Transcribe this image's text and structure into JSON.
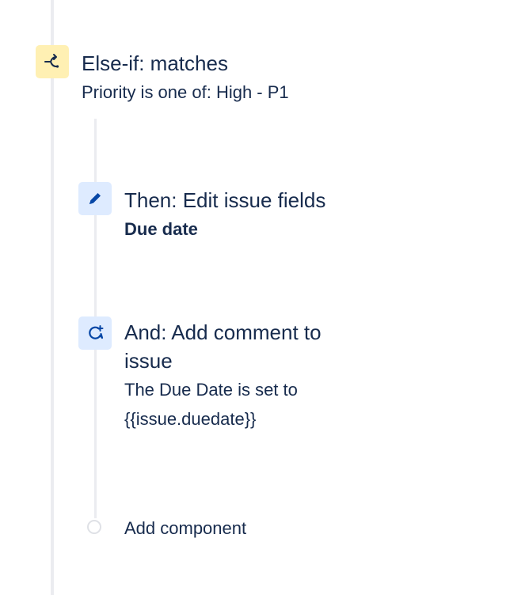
{
  "condition": {
    "icon": "branch-icon",
    "title": "Else-if: matches",
    "detail": "Priority is one of: High - P1",
    "color": "#fff0b3"
  },
  "actions": [
    {
      "icon": "pencil-icon",
      "title": "Then: Edit issue fields",
      "detail": "Due date"
    },
    {
      "icon": "comment-add-icon",
      "title_line1": "And: Add comment to",
      "title_line2": "issue",
      "detail_line1": "The Due Date is set to",
      "detail_line2": "{{issue.duedate}}"
    }
  ],
  "add_component": {
    "label": "Add component"
  },
  "colors": {
    "text": "#172b4d",
    "action_bg": "#deebff",
    "action_icon": "#0747a6",
    "rail": "#ebecf0"
  }
}
